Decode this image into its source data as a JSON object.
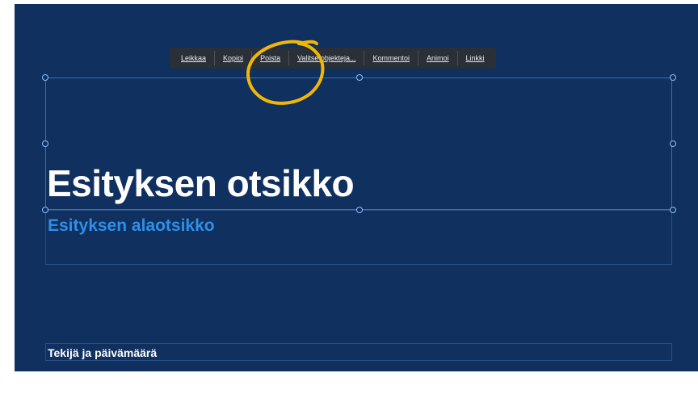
{
  "context_menu": {
    "items": [
      {
        "label": "Leikkaa"
      },
      {
        "label": "Kopioi"
      },
      {
        "label": "Poista"
      },
      {
        "label": "Valitse objekteja..."
      },
      {
        "label": "Kommentoi"
      },
      {
        "label": "Animoi"
      },
      {
        "label": "Linkki"
      }
    ]
  },
  "slide": {
    "title": "Esityksen otsikko",
    "subtitle": "Esityksen alaotsikko",
    "author_date": "Tekijä ja päivämäärä"
  },
  "colors": {
    "slide_background": "#10305f",
    "subtitle_text": "#2f8fe6",
    "annotation_circle": "#f2b705"
  }
}
